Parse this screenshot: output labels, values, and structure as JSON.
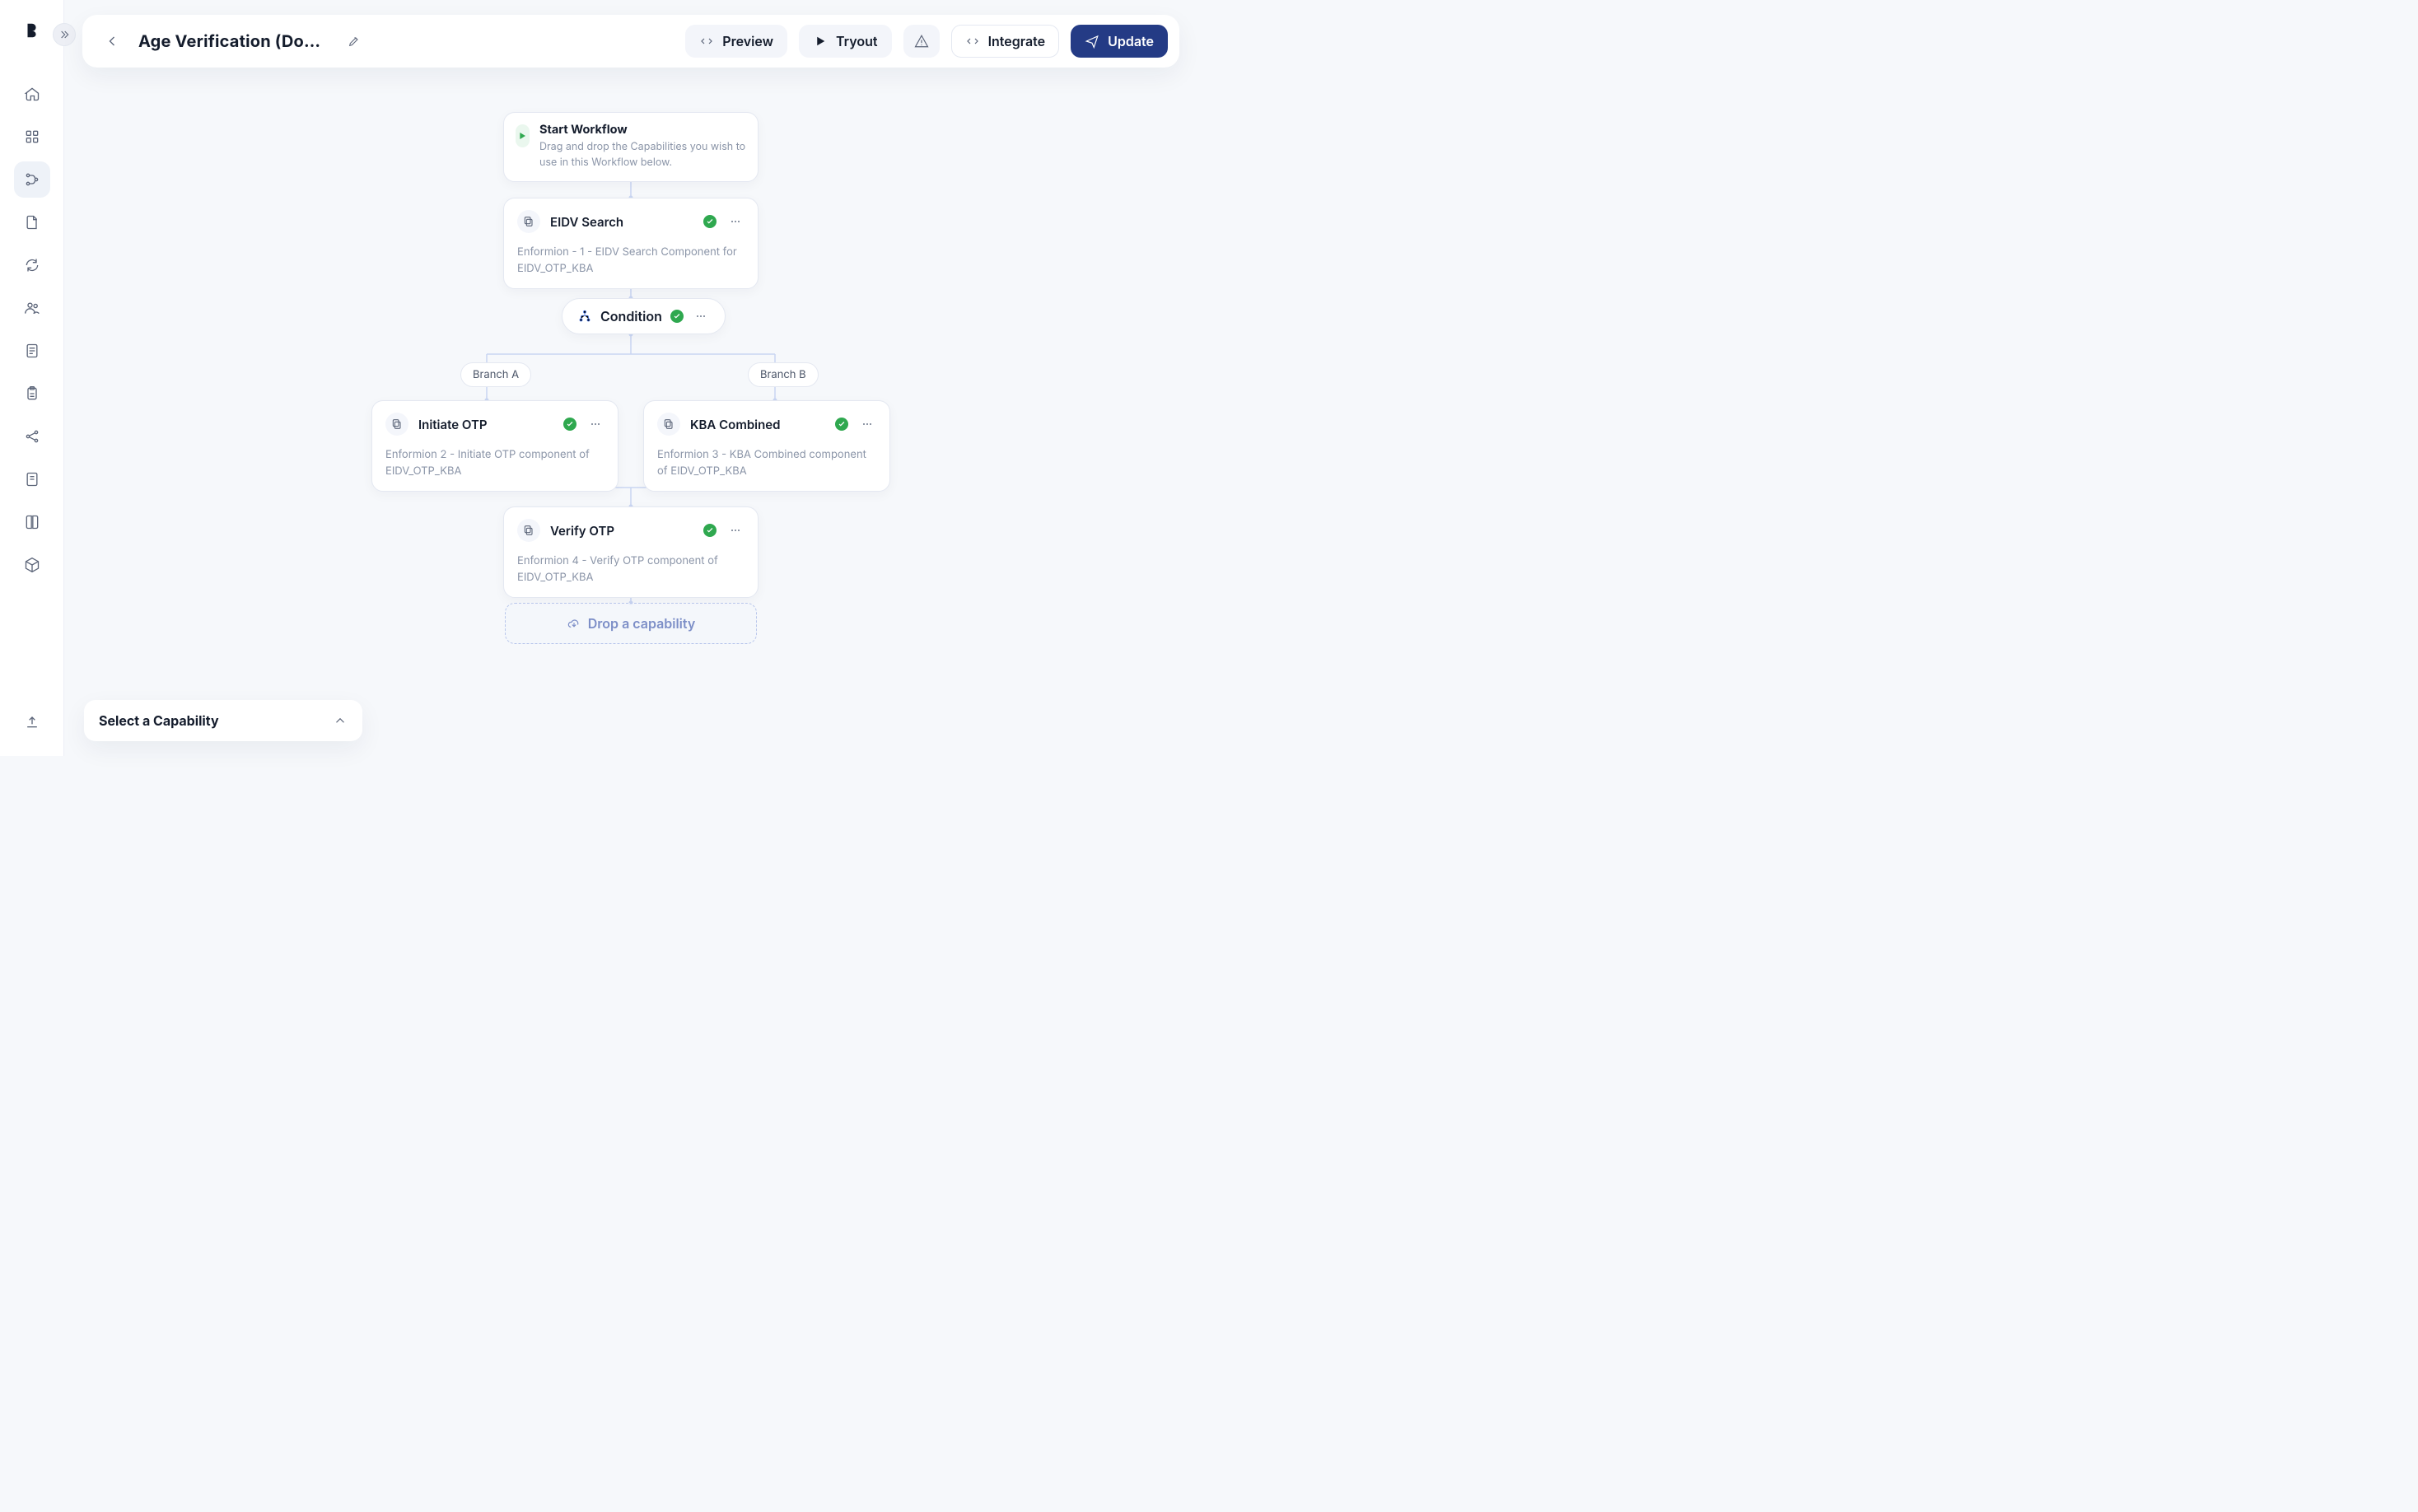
{
  "header": {
    "title": "Age Verification (Docu…",
    "preview": "Preview",
    "tryout": "Tryout",
    "integrate": "Integrate",
    "update": "Update"
  },
  "flow": {
    "start": {
      "title": "Start Workflow",
      "desc": "Drag and drop the Capabilities you wish to use in this Workflow below."
    },
    "eidv": {
      "title": "EIDV Search",
      "subtitle": "Enformion - 1 - EIDV Search Component for EIDV_OTP_KBA"
    },
    "condition": {
      "label": "Condition"
    },
    "branchA": "Branch A",
    "branchB": "Branch B",
    "initiate": {
      "title": "Initiate OTP",
      "subtitle": "Enformion 2 - Initiate OTP component of EIDV_OTP_KBA"
    },
    "kba": {
      "title": "KBA Combined",
      "subtitle": "Enformion 3 - KBA Combined component of EIDV_OTP_KBA"
    },
    "verify": {
      "title": "Verify OTP",
      "subtitle": "Enformion 4 - Verify OTP component of EIDV_OTP_KBA"
    },
    "drop": "Drop a capability"
  },
  "selectCap": {
    "label": "Select a Capability"
  }
}
